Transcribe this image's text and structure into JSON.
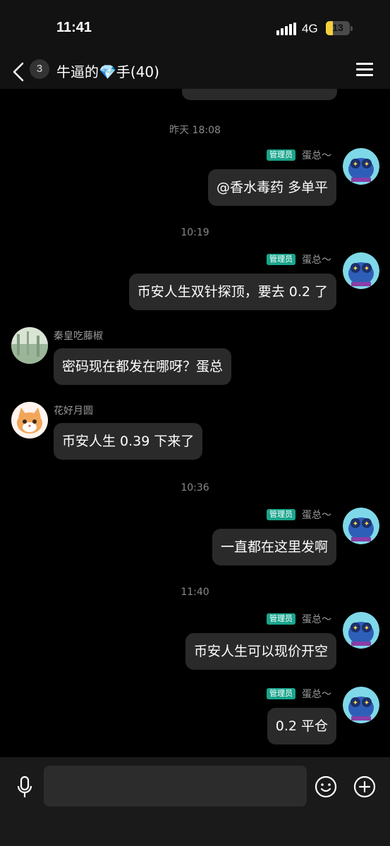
{
  "status": {
    "time": "11:41",
    "network": "4G",
    "battery": "13"
  },
  "header": {
    "unread_count": "3",
    "title": "牛逼的💎手(40)"
  },
  "messages": [
    {
      "type": "timestamp",
      "text": "昨天 18:08"
    },
    {
      "type": "outgoing",
      "badge": "管理员",
      "sender": "蛋总～",
      "text": "@香水毒药 多单平"
    },
    {
      "type": "timestamp",
      "text": "10:19"
    },
    {
      "type": "outgoing",
      "badge": "管理员",
      "sender": "蛋总～",
      "text": "币安人生双针探顶，要去 0.2 了"
    },
    {
      "type": "incoming",
      "sender": "秦皇吃藤椒",
      "text": "密码现在都发在哪呀？蛋总"
    },
    {
      "type": "incoming",
      "sender": "花好月圆",
      "text": "币安人生 0.39 下来了"
    },
    {
      "type": "timestamp",
      "text": "10:36"
    },
    {
      "type": "outgoing",
      "badge": "管理员",
      "sender": "蛋总～",
      "text": "一直都在这里发啊"
    },
    {
      "type": "timestamp",
      "text": "11:40"
    },
    {
      "type": "outgoing",
      "badge": "管理员",
      "sender": "蛋总～",
      "text": "币安人生可以现价开空"
    },
    {
      "type": "outgoing",
      "badge": "管理员",
      "sender": "蛋总～",
      "text": "0.2 平仓"
    }
  ],
  "colors": {
    "admin_badge": "#1aa58c",
    "bubble": "#2a2a2a",
    "background": "#000000"
  }
}
